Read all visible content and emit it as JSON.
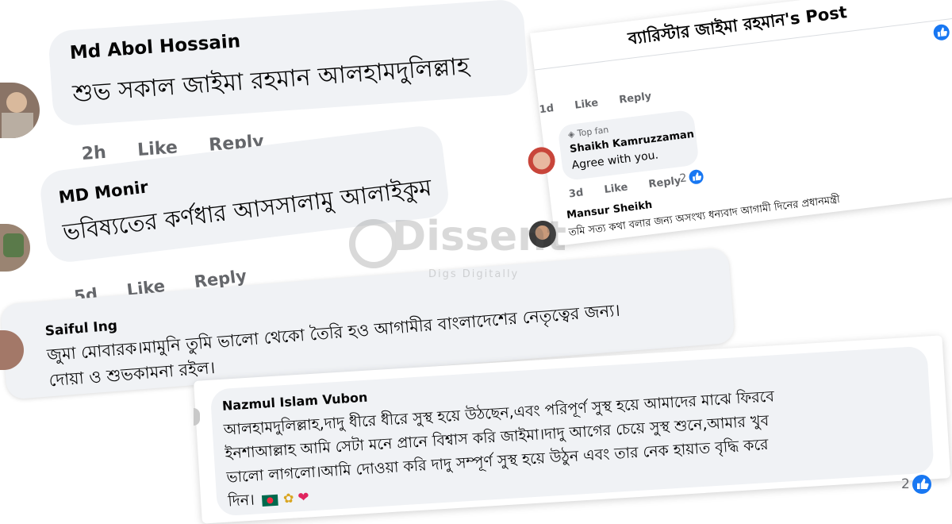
{
  "colors": {
    "bubble": "#f0f2f5",
    "meta": "#65676b",
    "fb_blue": "#1877f2",
    "text": "#050505"
  },
  "post_card": {
    "title": "ব্যারিস্টার জাইমা রহমান's Post",
    "prev_actions": {
      "time": "1d",
      "like": "Like",
      "reply": "Reply"
    },
    "comment1": {
      "badge_icon": "diamond-icon",
      "badge": "Top fan",
      "name": "Shaikh Kamruzzaman",
      "text": "Agree with you.",
      "time": "3d",
      "like": "Like",
      "reply": "Reply",
      "reactions": "2"
    },
    "comment2": {
      "name": "Mansur Sheikh",
      "text": "তমি সত্য কথা বলার জন্য অসংখ্য ধন্যবাদ আগামী দিনের প্রধানমন্ত্রী"
    }
  },
  "comment_abol": {
    "name": "Md Abol Hossain",
    "text": "শুভ সকাল জাইমা রহমান আলহামদুলিল্লাহ",
    "time": "2h",
    "like": "Like",
    "reply": "Reply"
  },
  "comment_monir": {
    "name": "MD Monir",
    "text": "ভবিষ্যতের কর্ণধার আসসালামু আলাইকুম",
    "time": "5d",
    "like": "Like",
    "reply": "Reply"
  },
  "comment_saiful": {
    "name": "Saiful Ing",
    "line1": "জুমা মোবারক।মামুনি তুমি ভালো থেকো তৈরি হও আগামীর বাংলাদেশের নেতৃত্বের জন্য।",
    "line2": "দোয়া ও শুভকামনা রইল।"
  },
  "comment_nazmul": {
    "name": "Nazmul Islam Vubon",
    "line1": "আলহামদুলিল্লাহ,দাদু ধীরে ধীরে সুস্থ হয়ে উঠছেন,এবং পরিপূর্ণ সুস্থ হয়ে আমাদের মাঝে ফিরবে",
    "line2": "ইনশাআল্লাহ আমি সেটা মনে প্রানে বিশ্বাস করি জাইমা।দাদু আগের চেয়ে সুস্থ শুনে,আমার খুব",
    "line3": "ভালো লাগলো।আমি দোওয়া করি দাদু সম্পূর্ণ সুস্থ হয়ে উঠুন এবং তার নেক হায়াত বৃদ্ধি করে",
    "line4": "দিন।",
    "reactions": "2"
  },
  "watermark": {
    "brand": "Dissent",
    "tagline": "Digs Digitally"
  }
}
